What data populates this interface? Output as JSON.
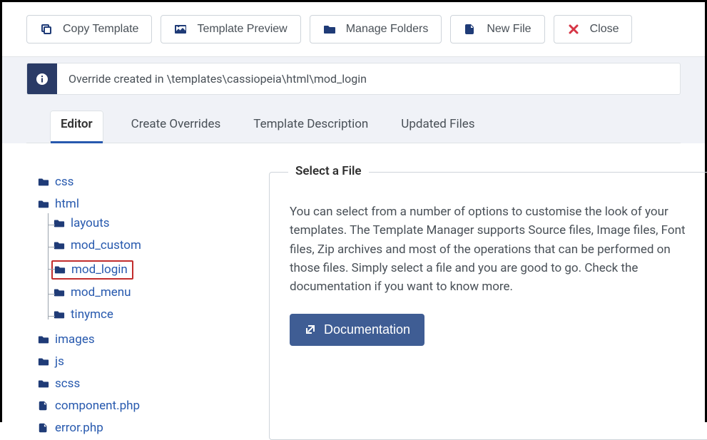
{
  "toolbar": {
    "copy_template": "Copy Template",
    "template_preview": "Template Preview",
    "manage_folders": "Manage Folders",
    "new_file": "New File",
    "close": "Close"
  },
  "alert": {
    "message": "Override created in \\templates\\cassiopeia\\html\\mod_login"
  },
  "tabs": {
    "editor": "Editor",
    "create_overrides": "Create Overrides",
    "template_description": "Template Description",
    "updated_files": "Updated Files"
  },
  "tree": {
    "css": "css",
    "html": "html",
    "layouts": "layouts",
    "mod_custom": "mod_custom",
    "mod_login": "mod_login",
    "mod_menu": "mod_menu",
    "tinymce": "tinymce",
    "images": "images",
    "js": "js",
    "scss": "scss",
    "component_php": "component.php",
    "error_php": "error.php"
  },
  "panel": {
    "legend": "Select a File",
    "body": "You can select from a number of options to customise the look of your templates. The Template Manager supports Source files, Image files, Font files, Zip archives and most of the operations that can be performed on those files. Simply select a file and you are good to go. Check the documentation if you want to know more.",
    "doc_button": "Documentation"
  }
}
